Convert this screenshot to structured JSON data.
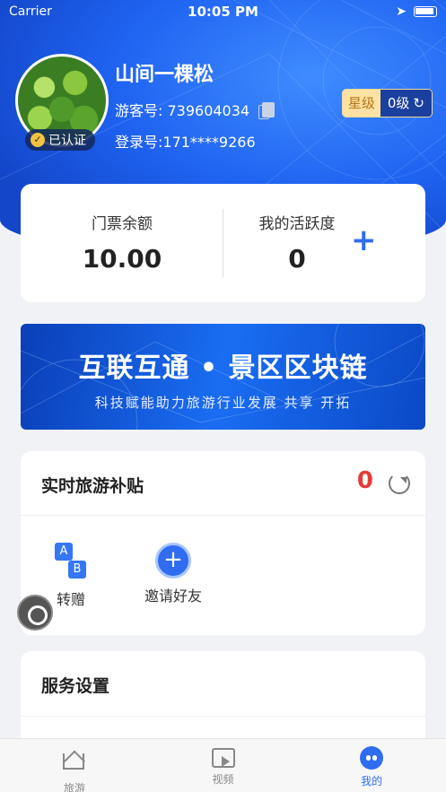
{
  "status": {
    "carrier": "Carrier",
    "time": "10:05 PM"
  },
  "profile": {
    "username": "山间一棵松",
    "guest_label": "游客号: 739604034",
    "login_label": "登录号:171****9266",
    "verified": "已认证",
    "level_star": "星级",
    "level_value": "0级"
  },
  "stats": {
    "ticket_label": "门票余额",
    "ticket_value": "10.00",
    "activity_label": "我的活跃度",
    "activity_value": "0",
    "add_symbol": "+"
  },
  "banner": {
    "title": "互联互通 • 景区区块链",
    "subtitle": "科技赋能助力旅游行业发展  共享  开拓"
  },
  "subsidy": {
    "title": "实时旅游补贴",
    "count": "0",
    "actions": [
      {
        "label": "转赠",
        "icon": "transfer-ab-icon"
      },
      {
        "label": "邀请好友",
        "icon": "plus-circle-icon"
      }
    ]
  },
  "service": {
    "title": "服务设置"
  },
  "tabs": [
    {
      "label": "旅游",
      "icon": "home-icon",
      "active": false
    },
    {
      "label": "视频",
      "icon": "video-icon",
      "active": false
    },
    {
      "label": "我的",
      "icon": "profile-icon",
      "active": true
    }
  ],
  "colors": {
    "primary": "#2f6cf0",
    "accent_red": "#e83a35",
    "gold": "#fde2a3"
  }
}
